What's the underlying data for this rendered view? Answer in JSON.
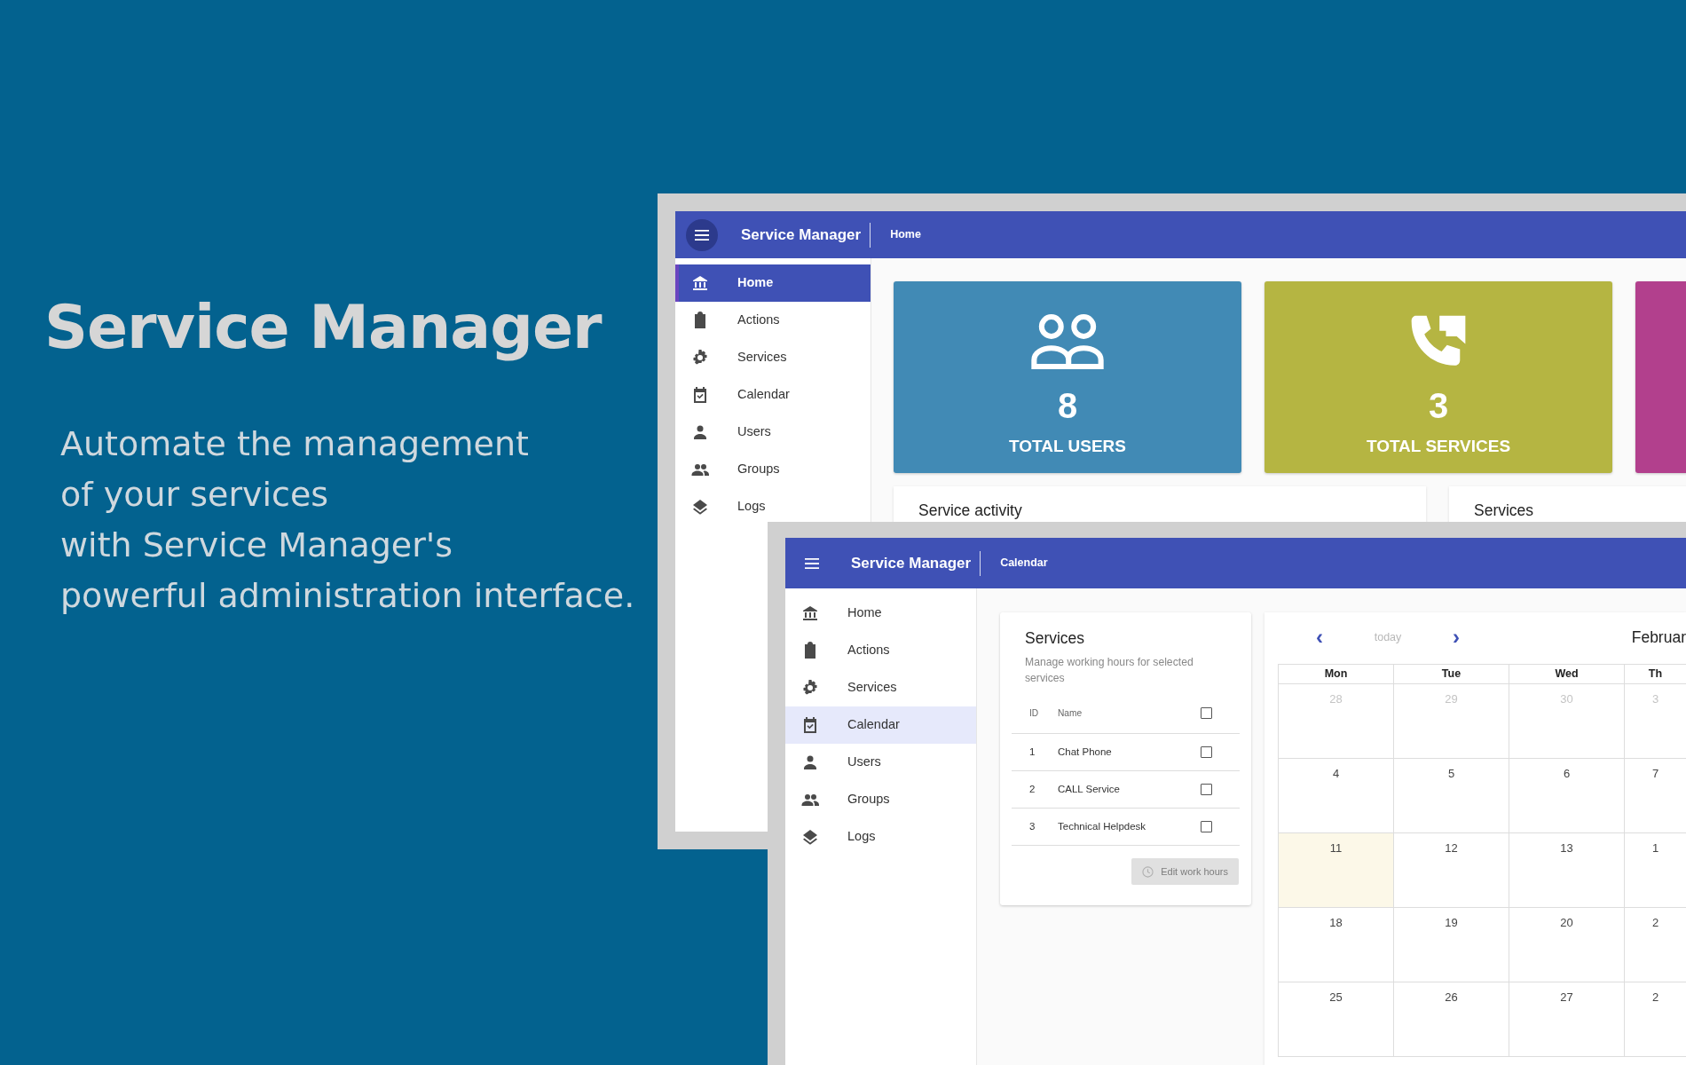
{
  "hero": {
    "title": "Service Manager",
    "lines": [
      "Automate the management",
      "of your services",
      "with Service Manager's",
      "powerful administration interface."
    ]
  },
  "windows": [
    {
      "kind": "dashboard",
      "menu_pressed": true,
      "title": "Service Manager",
      "breadcrumb": "Home",
      "sidebar": [
        {
          "kind": "home",
          "label": "Home",
          "selected": true
        },
        {
          "kind": "actions",
          "label": "Actions",
          "selected": false
        },
        {
          "kind": "services",
          "label": "Services",
          "selected": false
        },
        {
          "kind": "calendar",
          "label": "Calendar",
          "selected": false
        },
        {
          "kind": "users",
          "label": "Users",
          "selected": false
        },
        {
          "kind": "groups",
          "label": "Groups",
          "selected": false
        },
        {
          "kind": "logs",
          "label": "Logs",
          "selected": false
        }
      ],
      "stats": [
        {
          "kind": "users",
          "number": "8",
          "label": "TOTAL USERS",
          "color": "#418ab5"
        },
        {
          "kind": "calls",
          "number": "3",
          "label": "TOTAL SERVICES",
          "color": "#b5b542"
        },
        {
          "kind": "blank",
          "color": "#b2408d"
        }
      ],
      "panels": [
        "Service activity",
        "Services"
      ]
    },
    {
      "kind": "calendar",
      "menu_pressed": false,
      "title": "Service Manager",
      "breadcrumb": "Calendar",
      "sidebar": [
        {
          "kind": "home",
          "label": "Home",
          "selected": false
        },
        {
          "kind": "actions",
          "label": "Actions",
          "selected": false
        },
        {
          "kind": "services",
          "label": "Services",
          "selected": false
        },
        {
          "kind": "calendar",
          "label": "Calendar",
          "selected": true
        },
        {
          "kind": "users",
          "label": "Users",
          "selected": false
        },
        {
          "kind": "groups",
          "label": "Groups",
          "selected": false
        },
        {
          "kind": "logs",
          "label": "Logs",
          "selected": false
        }
      ],
      "services_card": {
        "title": "Services",
        "subtitle": "Manage working hours for selected services",
        "columns": [
          "ID",
          "Name"
        ],
        "all_checked": false,
        "rows": [
          {
            "id": "1",
            "name": "Chat Phone",
            "checked": false
          },
          {
            "id": "2",
            "name": "CALL Service",
            "checked": false
          },
          {
            "id": "3",
            "name": "Technical Helpdesk",
            "checked": false
          }
        ],
        "button": {
          "label": "Edit work hours",
          "disabled": true
        }
      },
      "calendar": {
        "prev": "‹",
        "today": {
          "label": "today",
          "disabled": true
        },
        "next": "›",
        "month": "Februar",
        "weekdays": [
          "Mon",
          "Tue",
          "Wed",
          "Th"
        ],
        "weeks": [
          [
            {
              "day": "28",
              "muted": true
            },
            {
              "day": "29",
              "muted": true
            },
            {
              "day": "30",
              "muted": true
            },
            {
              "day": "3",
              "muted": true
            }
          ],
          [
            {
              "day": "4",
              "muted": false
            },
            {
              "day": "5",
              "muted": false
            },
            {
              "day": "6",
              "muted": false
            },
            {
              "day": "7",
              "muted": false
            }
          ],
          [
            {
              "day": "11",
              "muted": false,
              "today": true
            },
            {
              "day": "12",
              "muted": false
            },
            {
              "day": "13",
              "muted": false
            },
            {
              "day": "1",
              "muted": false
            }
          ],
          [
            {
              "day": "18",
              "muted": false
            },
            {
              "day": "19",
              "muted": false
            },
            {
              "day": "20",
              "muted": false
            },
            {
              "day": "2",
              "muted": false
            }
          ],
          [
            {
              "day": "25",
              "muted": false
            },
            {
              "day": "26",
              "muted": false
            },
            {
              "day": "27",
              "muted": false
            },
            {
              "day": "2",
              "muted": false
            }
          ]
        ]
      }
    }
  ]
}
